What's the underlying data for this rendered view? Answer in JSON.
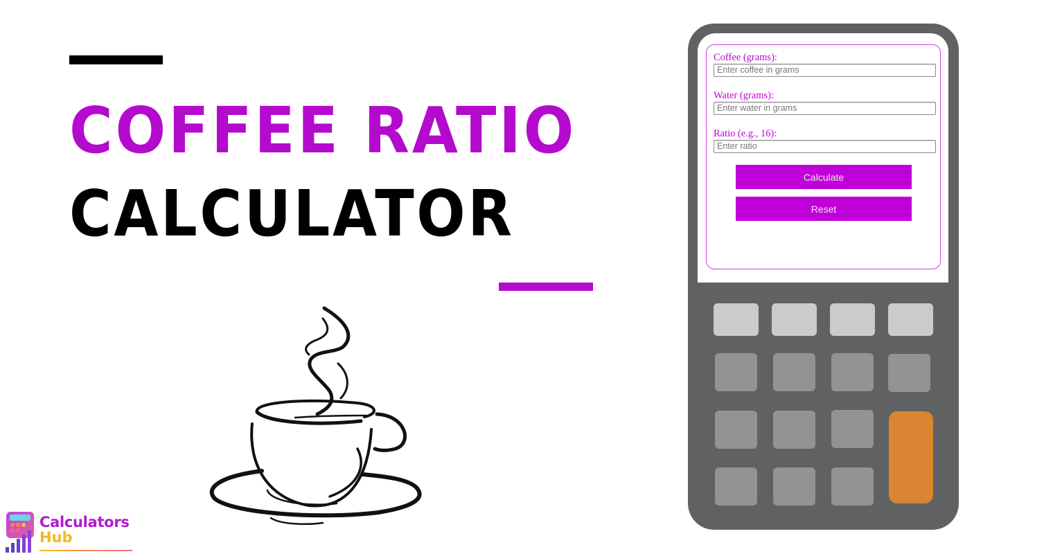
{
  "heading": {
    "line1": "COFFEE RATIO",
    "line2": "CALCULATOR"
  },
  "colors": {
    "accent": "#b40ace",
    "button": "#c000d8",
    "calculator_body": "#606163",
    "key_light": "#cccbc9",
    "key_mid": "#939393",
    "key_orange": "#d98531"
  },
  "illustration": "coffee-cup-icon",
  "form": {
    "fields": [
      {
        "label": "Coffee (grams):",
        "placeholder": "Enter coffee in grams",
        "value": ""
      },
      {
        "label": "Water (grams):",
        "placeholder": "Enter water in grams",
        "value": ""
      },
      {
        "label": "Ratio (e.g., 16):",
        "placeholder": "Enter ratio",
        "value": ""
      }
    ],
    "calculate_label": "Calculate",
    "reset_label": "Reset"
  },
  "logo": {
    "line1": "Calculators",
    "line2": "Hub"
  }
}
